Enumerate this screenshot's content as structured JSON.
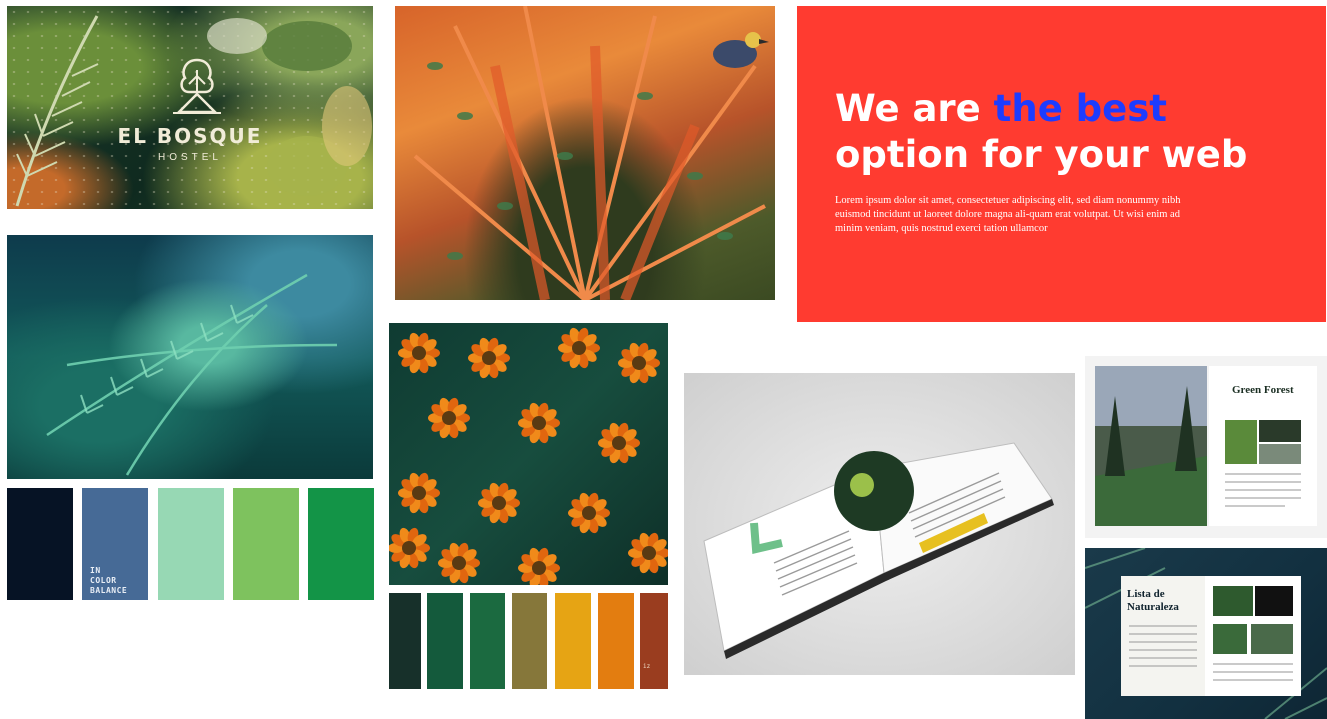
{
  "logo_card": {
    "brand_name": "EL BOSQUE",
    "brand_sub": "HOSTEL"
  },
  "headline_card": {
    "headline_part1": "We are ",
    "headline_highlight": "the best",
    "headline_part2": "option for your web",
    "body": "Lorem ipsum dolor sit amet, consectetuer adipiscing elit, sed diam nonummy nibh euismod tincidunt ut laoreet dolore magna ali-quam erat volutpat. Ut wisi enim ad minim veniam, quis nostrud exerci tation ullamcor",
    "background_color": "#ff3b30",
    "highlight_color": "#1d3cff"
  },
  "palette_blue_green": {
    "label": "IN\nCOLOR\nBALANCE",
    "swatches": [
      "#061325",
      "#466a96",
      "#97d8b4",
      "#7ec25e",
      "#139447"
    ]
  },
  "palette_orange": {
    "label": "iz",
    "swatches": [
      "#17302a",
      "#145a3c",
      "#1b6a40",
      "#86773a",
      "#e6a414",
      "#e37d10",
      "#9a3d1f"
    ]
  },
  "brochure_top": {
    "title": "Green Forest"
  },
  "brochure_bottom": {
    "title": "Lista de\nNaturaleza"
  }
}
